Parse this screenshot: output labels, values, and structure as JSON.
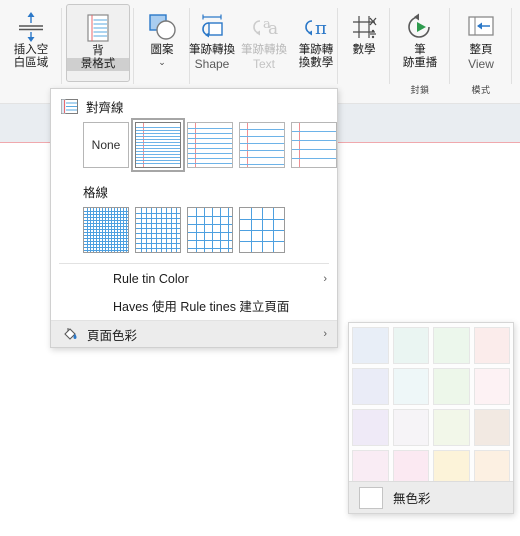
{
  "ribbon": {
    "groups": [
      {
        "label": "",
        "buttons": [
          {
            "name": "insert-space",
            "icon": "insert-space-icon",
            "line1": "插入空",
            "line2": "白區域"
          }
        ]
      },
      {
        "label": "",
        "buttons": [
          {
            "name": "background-format",
            "icon": "ruled-page-icon",
            "line1": "背",
            "line2": "景格式",
            "active": true
          }
        ]
      },
      {
        "label": "",
        "buttons": [
          {
            "name": "shapes",
            "icon": "shapes-icon",
            "line1": "圖案",
            "line2": "",
            "caret": "⌄"
          }
        ]
      },
      {
        "label": "",
        "buttons": [
          {
            "name": "ink-to-shape",
            "icon": "ink-to-shape-icon",
            "line1": "筆跡轉換",
            "line2": "",
            "sub": "Shape"
          },
          {
            "name": "ink-to-text",
            "icon": "ink-to-text-icon",
            "line1": "筆跡轉換",
            "line2": "",
            "sub": "Text",
            "dim": true
          },
          {
            "name": "ink-to-math",
            "icon": "ink-to-math-icon",
            "line1": "筆跡轉",
            "line2": "換數學"
          }
        ]
      },
      {
        "label": "",
        "buttons": [
          {
            "name": "math",
            "icon": "math-icon",
            "line1": "數學",
            "line2": ""
          }
        ]
      },
      {
        "label": "封鎖",
        "buttons": [
          {
            "name": "ink-replay",
            "icon": "ink-replay-icon",
            "line1": "筆",
            "line2": "跡重播"
          }
        ]
      },
      {
        "label": "模式",
        "buttons": [
          {
            "name": "full-page-view",
            "icon": "full-page-view-icon",
            "line1": "整頁",
            "line2": "",
            "sub": "View"
          }
        ]
      }
    ]
  },
  "menu": {
    "rule_lines": {
      "icon": "rule-lines-icon",
      "title": "對齊線",
      "options": [
        {
          "name": "none",
          "label": "None",
          "type": "none"
        },
        {
          "name": "narrow-ruled",
          "label": "",
          "type": "lines",
          "spacing": 3,
          "selected": true
        },
        {
          "name": "college-ruled",
          "label": "",
          "type": "lines",
          "spacing": 5
        },
        {
          "name": "standard-ruled",
          "label": "",
          "type": "lines",
          "spacing": 7
        },
        {
          "name": "wide-ruled",
          "label": "",
          "type": "lines",
          "spacing": 9
        }
      ]
    },
    "grid_lines": {
      "title": "格線",
      "options": [
        {
          "name": "small-grid",
          "spacing": 3
        },
        {
          "name": "medium-grid",
          "spacing": 5
        },
        {
          "name": "large-grid",
          "spacing": 8
        },
        {
          "name": "very-large-grid",
          "spacing": 11
        }
      ]
    },
    "items": [
      {
        "name": "rule-line-color",
        "label": "Rule tin Color",
        "arrow": "›",
        "indent": true,
        "icon": ""
      },
      {
        "name": "always-create-pages-with-rule-lines",
        "label": "Haves 使用 Rule tines 建立頁面",
        "arrow": "",
        "indent": true,
        "icon": ""
      },
      {
        "name": "page-color",
        "label": "頁面色彩",
        "arrow": "›",
        "indent": false,
        "icon": "paint-bucket-icon",
        "highlighted": true
      }
    ]
  },
  "palette": {
    "swatches": [
      "#e8eef7",
      "#eaf5f2",
      "#ecf7ec",
      "#fbeceb",
      "#eaecf7",
      "#eef7f8",
      "#edf7ea",
      "#fdf2f4",
      "#efeaf7",
      "#f6f4f7",
      "#f2f7e9",
      "#f2e9e2",
      "#f9ecf4",
      "#fbe9f2",
      "#fcf3d9",
      "#fcf0e2"
    ],
    "no_color_label": "無色彩"
  }
}
